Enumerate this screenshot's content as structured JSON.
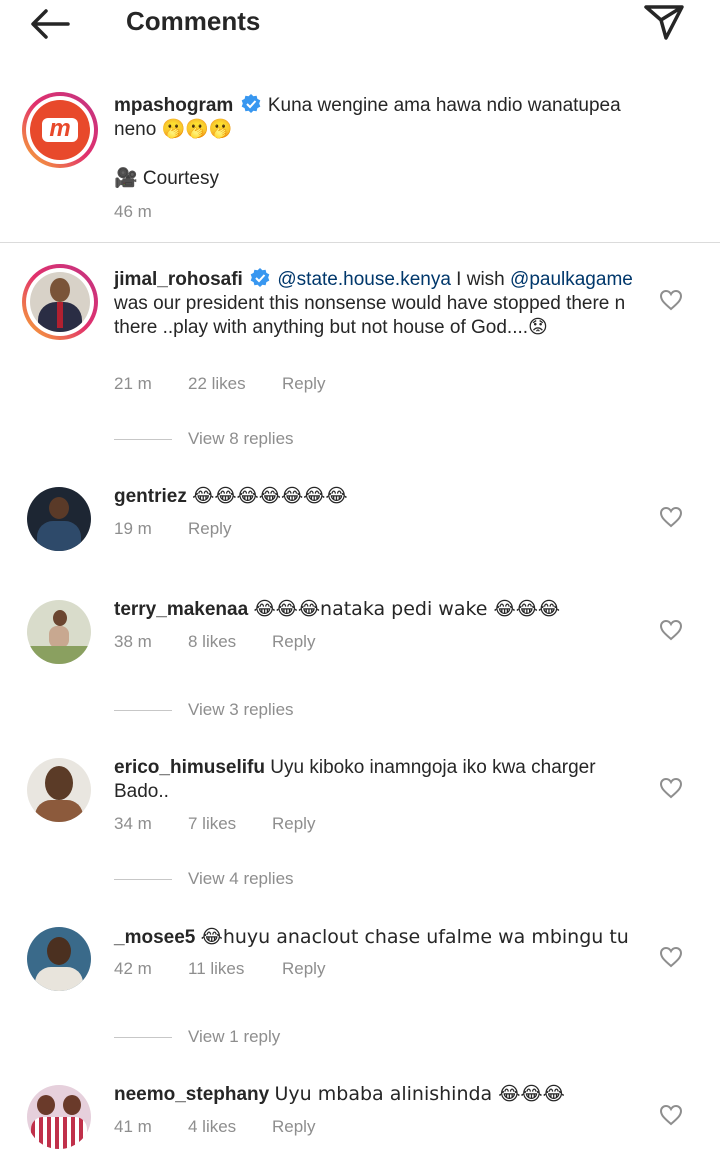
{
  "header": {
    "title": "Comments"
  },
  "caption": {
    "username": "mpashogram",
    "text": "Kuna wengine ama hawa ndio wanatupea neno 🫢🫢🫢",
    "line2": "🎥 Courtesy",
    "time": "46 m",
    "avatar_letter": "m"
  },
  "comments": [
    {
      "username": "jimal_rohosafi",
      "mention1": "@state.house.kenya",
      "text_a": " I wish ",
      "mention2": "@paulkagame",
      "text_b": " was our president this nonsense would have stopped there n there ..play with anything but not house of God....😟",
      "time": "21 m",
      "likes": "22 likes",
      "reply": "Reply",
      "view_replies": "View 8 replies"
    },
    {
      "username": "gentriez",
      "text": "😂😂😂😂😂😂😂",
      "time": "19 m",
      "reply": "Reply"
    },
    {
      "username": "terry_makenaa",
      "text": "😂😂😂nataka pedi wake 😂😂😂",
      "time": "38 m",
      "likes": "8 likes",
      "reply": "Reply",
      "view_replies": "View 3 replies"
    },
    {
      "username": "erico_himuselifu",
      "text": "Uyu kiboko inamngoja iko kwa charger Bado..",
      "time": "34 m",
      "likes": "7 likes",
      "reply": "Reply",
      "view_replies": "View 4 replies"
    },
    {
      "username": "_mosee5",
      "text": "😂huyu anaclout chase ufalme wa mbingu tu",
      "time": "42 m",
      "likes": "11 likes",
      "reply": "Reply",
      "view_replies": "View 1 reply"
    },
    {
      "username": "neemo_stephany",
      "text": "Uyu mbaba alinishinda 😂😂😂",
      "time": "41 m",
      "likes": "4 likes",
      "reply": "Reply"
    }
  ],
  "colors": {
    "verified": "#3897f0",
    "mpasho": "#e8492b",
    "meta": "#8e8e8e",
    "mention": "#00376b"
  },
  "icons": [
    "back-arrow-icon",
    "send-icon",
    "verified-icon",
    "heart-icon"
  ]
}
